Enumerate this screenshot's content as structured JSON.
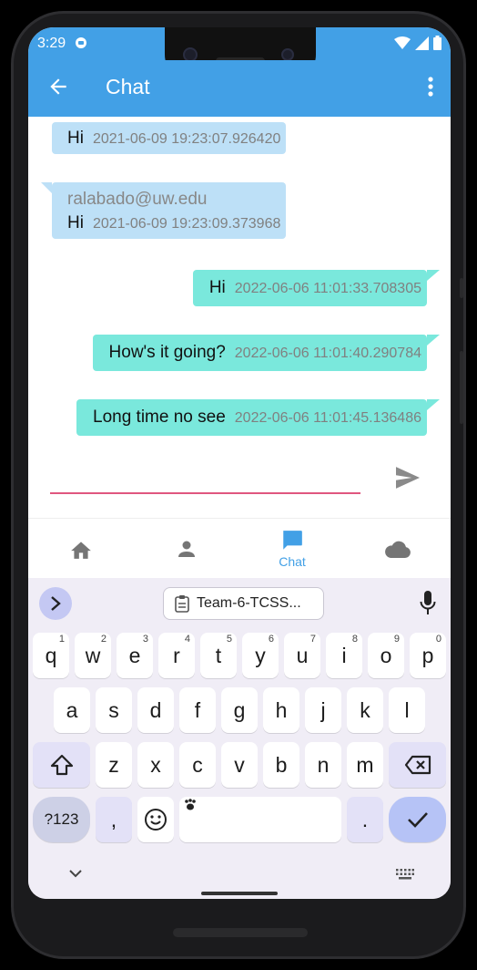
{
  "status_bar": {
    "time": "3:29"
  },
  "app_bar": {
    "title": "Chat"
  },
  "messages": [
    {
      "direction": "in",
      "sender": "",
      "text": "Hi",
      "timestamp": "2021-06-09 19:23:07.926420"
    },
    {
      "direction": "in",
      "sender": "ralabado@uw.edu",
      "text": "Hi",
      "timestamp": "2021-06-09 19:23:09.373968"
    },
    {
      "direction": "out",
      "sender": "",
      "text": "Hi",
      "timestamp": "2022-06-06 11:01:33.708305"
    },
    {
      "direction": "out",
      "sender": "",
      "text": "How's it going?",
      "timestamp": "2022-06-06 11:01:40.290784"
    },
    {
      "direction": "out",
      "sender": "",
      "text": "Long time no see",
      "timestamp": "2022-06-06 11:01:45.136486"
    }
  ],
  "composer": {
    "value": "",
    "placeholder": ""
  },
  "bottom_nav": [
    {
      "icon": "home-icon",
      "label": "",
      "active": false
    },
    {
      "icon": "person-icon",
      "label": "",
      "active": false
    },
    {
      "icon": "chat-icon",
      "label": "Chat",
      "active": true
    },
    {
      "icon": "cloud-icon",
      "label": "",
      "active": false
    }
  ],
  "keyboard": {
    "clipboard_chip": "Team-6-TCSS...",
    "row1": [
      "q",
      "w",
      "e",
      "r",
      "t",
      "y",
      "u",
      "i",
      "o",
      "p"
    ],
    "row1_hints": [
      "1",
      "2",
      "3",
      "4",
      "5",
      "6",
      "7",
      "8",
      "9",
      "0"
    ],
    "row2": [
      "a",
      "s",
      "d",
      "f",
      "g",
      "h",
      "j",
      "k",
      "l"
    ],
    "row3": [
      "z",
      "x",
      "c",
      "v",
      "b",
      "n",
      "m"
    ],
    "symbols_key": "?123",
    "comma_key": ",",
    "period_key": "."
  },
  "colors": {
    "app_bar": "#42a0e6",
    "incoming_bubble": "#bde0f7",
    "outgoing_bubble": "#7ae8dc",
    "input_underline": "#e0577f",
    "nav_active": "#42a0e6"
  }
}
